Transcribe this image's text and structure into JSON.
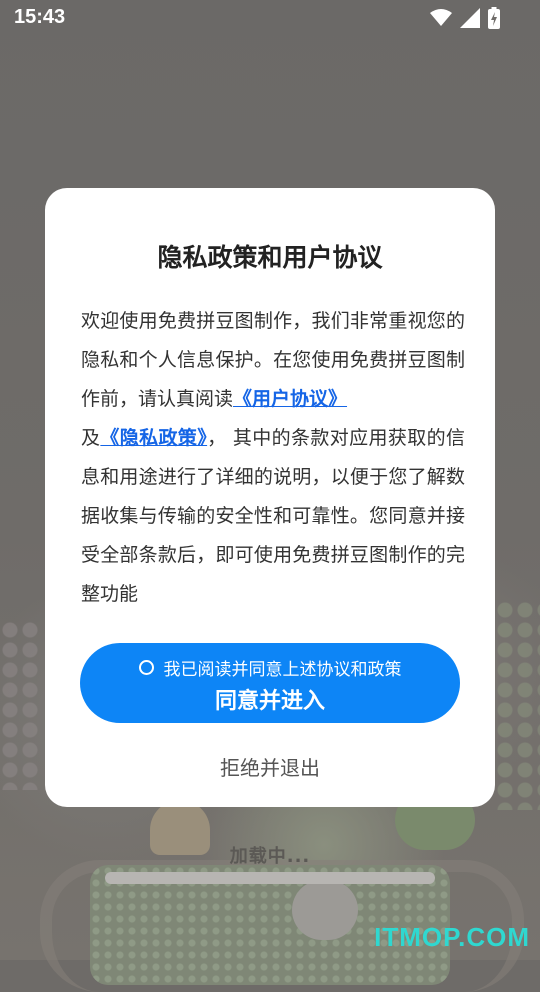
{
  "status_bar": {
    "time": "15:43",
    "icons": [
      "wifi-icon",
      "signal-icon",
      "battery-charging-icon"
    ]
  },
  "background": {
    "loading_text": "加载中...",
    "watermark": "ITMOP.COM"
  },
  "dialog": {
    "title": "隐私政策和用户协议",
    "body_1": "欢迎使用免费拼豆图制作，我们非常重视您的隐私和个人信息保护。在您使用免费拼豆图制作前，请认真阅读",
    "user_agreement_link": "《用户协议》",
    "body_2": "及",
    "privacy_policy_link": "《隐私政策》",
    "body_3": "， 其中的条款对应用获取的信息和用途进行了详细的说明，以便于您了解数据收集与传输的安全性和可靠性。您同意并接受全部条款后，即可使用免费拼豆图制作的完整功能",
    "checkbox_label": "我已阅读并同意上述协议和政策",
    "agree_button": "同意并进入",
    "reject_button": "拒绝并退出"
  },
  "colors": {
    "accent": "#0d85f6",
    "link": "#1565e6",
    "overlay": "#6e6b68",
    "watermark": "#2fd8d0"
  }
}
